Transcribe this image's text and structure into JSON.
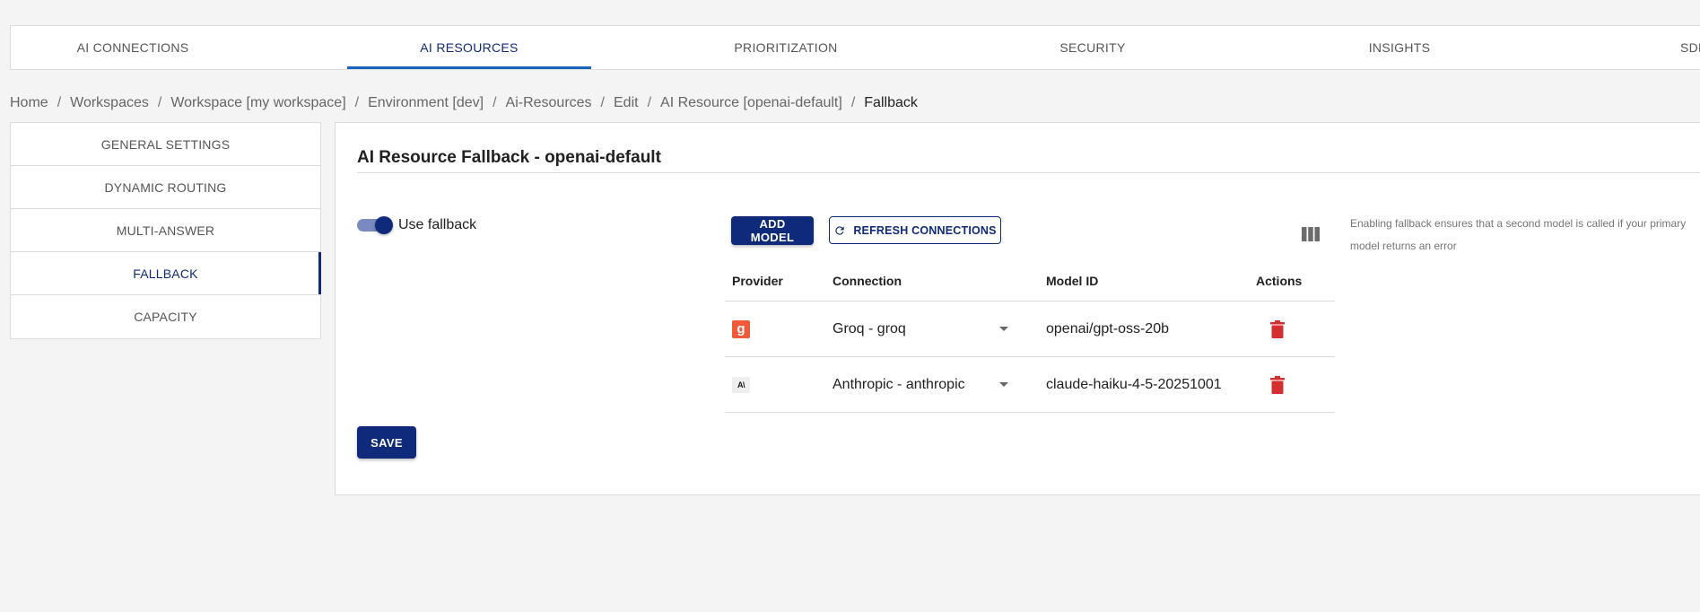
{
  "top_tabs": [
    {
      "label": "AI CONNECTIONS",
      "active": false
    },
    {
      "label": "AI RESOURCES",
      "active": true
    },
    {
      "label": "PRIORITIZATION",
      "active": false
    },
    {
      "label": "SECURITY",
      "active": false
    },
    {
      "label": "INSIGHTS",
      "active": false
    },
    {
      "label": "SDK",
      "active": false
    }
  ],
  "breadcrumb": [
    "Home",
    "Workspaces",
    "Workspace [my workspace]",
    "Environment [dev]",
    "Ai-Resources",
    "Edit",
    "AI Resource [openai-default]",
    "Fallback"
  ],
  "side_nav": [
    {
      "label": "GENERAL SETTINGS",
      "active": false
    },
    {
      "label": "DYNAMIC ROUTING",
      "active": false
    },
    {
      "label": "MULTI-ANSWER",
      "active": false
    },
    {
      "label": "FALLBACK",
      "active": true
    },
    {
      "label": "CAPACITY",
      "active": false
    }
  ],
  "main": {
    "title": "AI Resource Fallback - openai-default",
    "toggle": {
      "label": "Use fallback",
      "enabled": true
    },
    "add_model_label": "ADD MODEL",
    "refresh_label": "REFRESH CONNECTIONS",
    "help_text": "Enabling fallback ensures that a second model is called if your primary model returns an error",
    "save_label": "SAVE",
    "table": {
      "headers": {
        "provider": "Provider",
        "connection": "Connection",
        "model_id": "Model ID",
        "actions": "Actions"
      },
      "rows": [
        {
          "provider_icon": "groq-icon",
          "provider_glyph": "g",
          "connection": "Groq - groq",
          "model_id": "openai/gpt-oss-20b",
          "action_icon": "trash-icon"
        },
        {
          "provider_icon": "anthropic-icon",
          "provider_glyph": "A\\",
          "connection": "Anthropic - anthropic",
          "model_id": "claude-haiku-4-5-20251001",
          "action_icon": "trash-icon"
        }
      ]
    }
  },
  "colors": {
    "primary": "#0f2a7a",
    "tab_underline": "#1565c0",
    "delete": "#d32f2f",
    "groq": "#f05a3a",
    "background": "#f4f4f4"
  }
}
